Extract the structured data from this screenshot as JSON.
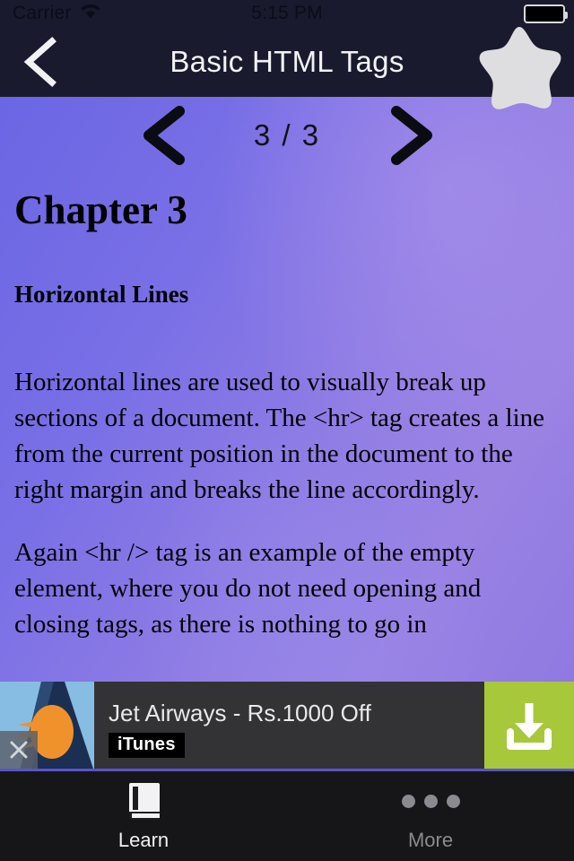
{
  "status_bar": {
    "carrier": "Carrier",
    "wifi_icon": "wifi-icon",
    "time": "5:15 PM",
    "battery_icon": "battery-full-icon"
  },
  "nav_bar": {
    "back_icon": "chevron-left-icon",
    "title": "Basic HTML Tags",
    "favorite_icon": "star-icon"
  },
  "pager": {
    "prev_icon": "chevron-left-icon",
    "next_icon": "chevron-right-icon",
    "label": "3 / 3",
    "current": 3,
    "total": 3
  },
  "document": {
    "chapter": "Chapter 3",
    "subheading": "Horizontal Lines",
    "paragraphs": [
      "Horizontal lines are used to visually break up sections of a document. The <hr> tag creates a line from the current position in the document to the right margin and breaks the line accordingly.",
      "Again <hr /> tag is an example of the empty element, where you do not need opening and closing tags, as there is nothing to go in"
    ]
  },
  "ad": {
    "close_icon": "close-icon",
    "logo_icon": "jet-airways-logo-icon",
    "title": "Jet Airways - Rs.1000 Off",
    "badge": "iTunes",
    "cta_icon": "download-icon",
    "cta_color": "#a8c83c"
  },
  "tab_bar": {
    "tabs": [
      {
        "label": "Learn",
        "icon": "book-icon",
        "active": true
      },
      {
        "label": "More",
        "icon": "ellipsis-icon",
        "active": false
      }
    ]
  },
  "colors": {
    "nav_background": "#1a1a2e",
    "content_gradient_start": "#6b66e4",
    "content_gradient_end": "#9a82e3",
    "ad_background": "#333336",
    "tab_background": "#161618",
    "accent_green": "#a8c83c"
  }
}
